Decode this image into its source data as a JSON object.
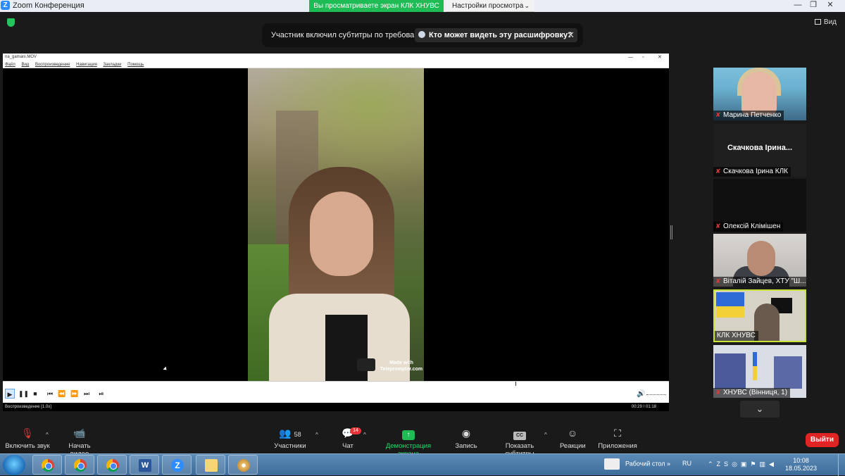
{
  "window": {
    "title": "Zoom Конференция",
    "sharing_banner": "Вы просматриваете экран КЛК ХНУВС",
    "view_options_label": "Настройки просмотра",
    "controls": [
      "—",
      "❐",
      "✕"
    ]
  },
  "view_button": {
    "label": "Вид"
  },
  "caption_notice": {
    "text": "Участник включил субтитры по требованию",
    "who_can_see": "Кто может видеть эту расшифровку?",
    "close": "✕"
  },
  "media_player": {
    "title": "na_gamani.MOV",
    "window_controls": [
      "—",
      "▫",
      "✕"
    ],
    "menu": [
      "Файл",
      "Вид",
      "Воспроизведение",
      "Навигация",
      "Закладки",
      "Помощь"
    ],
    "status_text": "Воспроизведение [1.0x]",
    "time": "00:29 / 01:18",
    "watermark": "Made with Teleprompter.com",
    "progress": 0.77
  },
  "participants": [
    {
      "name": "Марина Петченко",
      "muted": true
    },
    {
      "name": "Скачкова Ірина КЛК",
      "avatar_text": "Скачкова Ірина...",
      "muted": true
    },
    {
      "name": "Олексій Клімішен",
      "muted": true
    },
    {
      "name": "Віталій Зайцев, ХТУ \"Ш...",
      "muted": true
    },
    {
      "name": "КЛК ХНУВС",
      "muted": false,
      "active_speaker": true
    },
    {
      "name": "ХНУВС (Вінниця, 1)",
      "muted": true
    }
  ],
  "toolbar": {
    "audio": "Включить звук",
    "video": "Начать видео",
    "participants": "Участники",
    "participants_count": "58",
    "chat": "Чат",
    "chat_badge": "14",
    "share": "Демонстрация экрана",
    "record": "Запись",
    "captions": "Показать субтитры",
    "reactions": "Реакции",
    "apps": "Приложения",
    "exit": "Выйти"
  },
  "taskbar": {
    "desktop_label": "Рабочий стол",
    "language": "RU",
    "time": "10:08",
    "date": "18.05.2023",
    "apps": [
      "chrome",
      "chrome",
      "chrome",
      "word",
      "zoom",
      "file-explorer",
      "paint"
    ]
  },
  "colors": {
    "share_green": "#1fbb55",
    "exit_red": "#e02424",
    "active_speaker_border": "#c9e33a",
    "zoom_blue": "#2d8cff"
  }
}
